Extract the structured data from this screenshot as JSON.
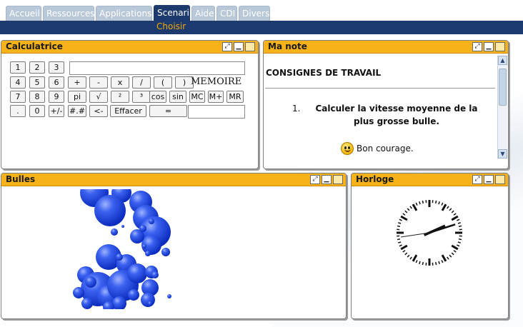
{
  "tabs": [
    "Accueil",
    "Ressources",
    "Applications",
    "Scenari",
    "Aide",
    "CDI",
    "Divers"
  ],
  "active_tab": "Scenari",
  "subnav": "Choisir",
  "panel_buttons": [
    "resize-icon",
    "minimize-icon",
    "close-icon"
  ],
  "calculator": {
    "title": "Calculatrice",
    "rows": [
      [
        "1",
        "2",
        "3"
      ],
      [
        "4",
        "5",
        "6",
        "+",
        "-",
        "x",
        "/",
        "(",
        ")"
      ],
      [
        "7",
        "8",
        "9",
        "pi",
        "√",
        "²",
        "³",
        "cos",
        "sin",
        "MC",
        "M+",
        "MR"
      ],
      [
        ".",
        "0",
        "+/-",
        "#.#",
        "<-",
        "Effacer",
        "="
      ]
    ],
    "memory_label": "MEMOIRE"
  },
  "note": {
    "title": "Ma note",
    "heading": "CONSIGNES DE TRAVAIL",
    "item_number": "1.",
    "item_text": "Calculer la vitesse moyenne de la plus grosse bulle.",
    "closing": "Bon courage."
  },
  "bubbles": {
    "title": "Bulles"
  },
  "clock": {
    "title": "Horloge",
    "hour": 2,
    "minute": 12
  },
  "colors": {
    "tab": "#b9c8d8",
    "nav": "#1c3a6e",
    "accent": "#f7b21a",
    "bubble": "#2a4fd8"
  }
}
